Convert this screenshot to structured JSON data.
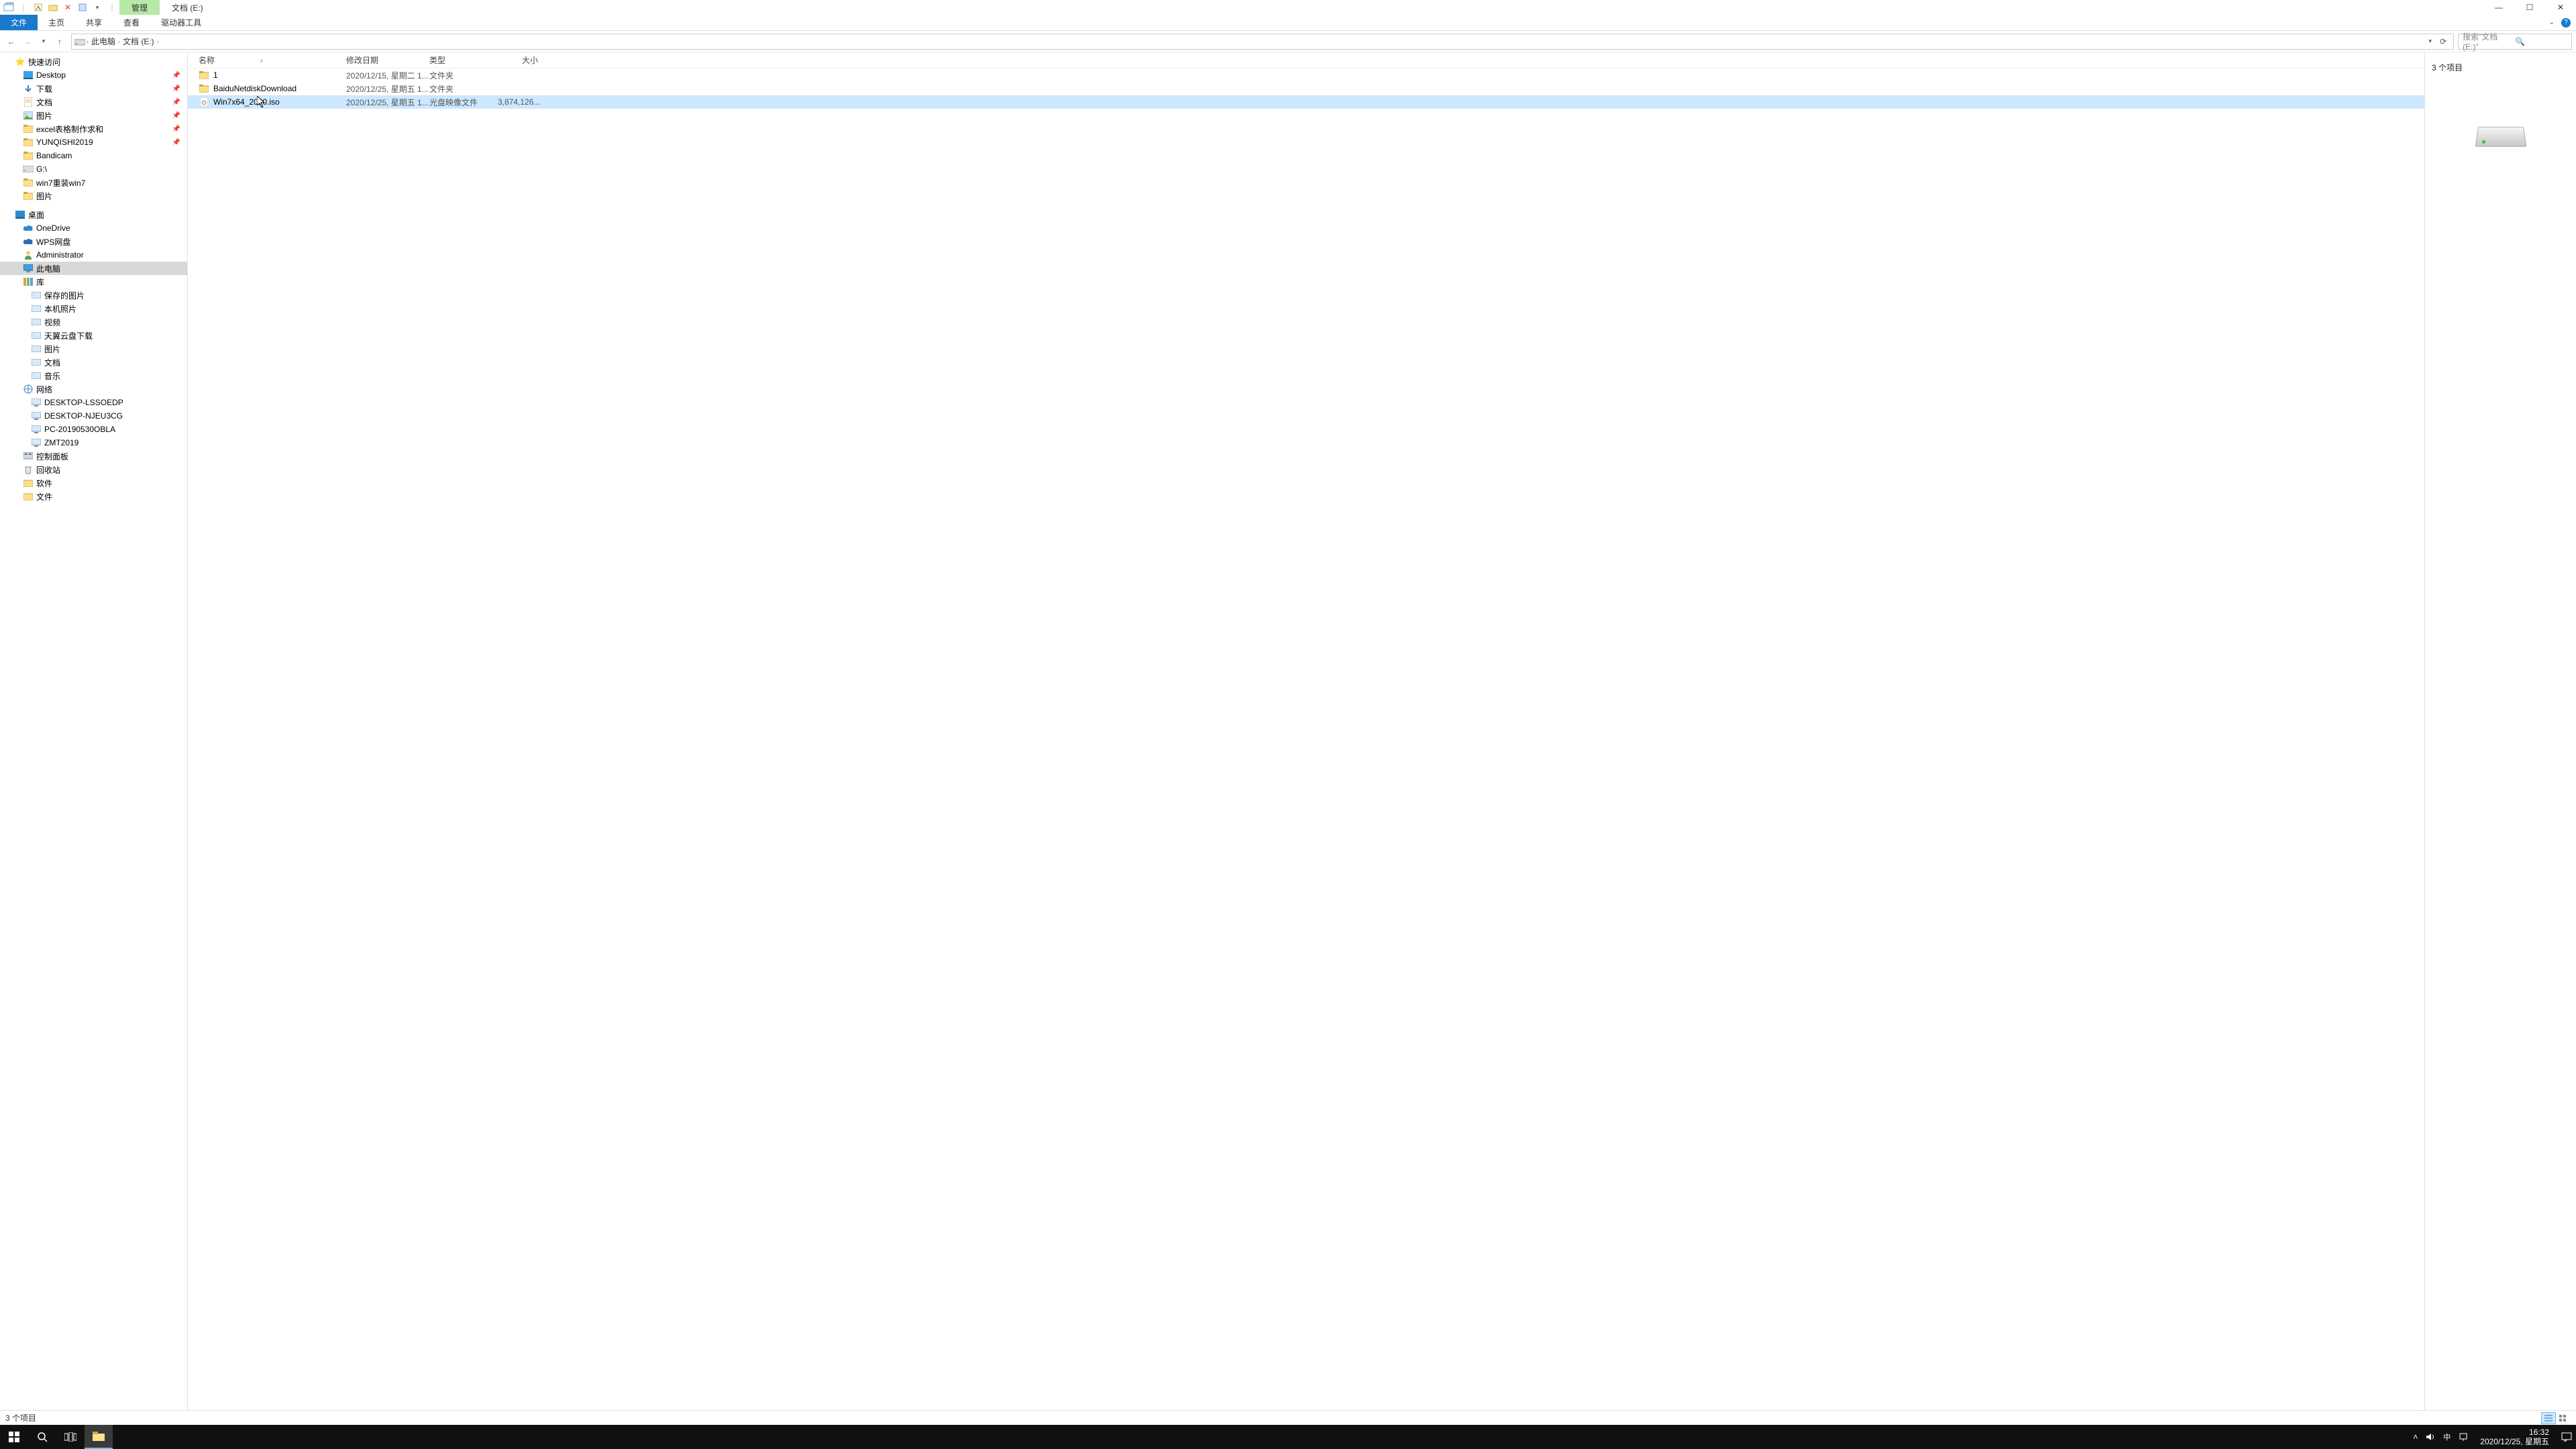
{
  "title_tab": {
    "manage": "管理",
    "location": "文档 (E:)"
  },
  "ribbon": {
    "file": "文件",
    "home": "主页",
    "share": "共享",
    "view": "查看",
    "drivetools": "驱动器工具"
  },
  "breadcrumbs": {
    "pc": "此电脑",
    "loc": "文档 (E:)"
  },
  "search": {
    "placeholder": "搜索\"文档 (E:)\""
  },
  "columns": {
    "name": "名称",
    "date": "修改日期",
    "type": "类型",
    "size": "大小"
  },
  "files": [
    {
      "name": "1",
      "date": "2020/12/15, 星期二 1...",
      "type": "文件夹",
      "size": ""
    },
    {
      "name": "BaiduNetdiskDownload",
      "date": "2020/12/25, 星期五 1...",
      "type": "文件夹",
      "size": ""
    },
    {
      "name": "Win7x64_2020.iso",
      "date": "2020/12/25, 星期五 1...",
      "type": "光盘映像文件",
      "size": "3,874,126..."
    }
  ],
  "preview": {
    "count": "3 个项目"
  },
  "status": {
    "text": "3 个项目"
  },
  "tree": {
    "quick": "快速访问",
    "quick_items": [
      {
        "l": "Desktop",
        "pin": true,
        "i": "desktop"
      },
      {
        "l": "下载",
        "pin": true,
        "i": "down"
      },
      {
        "l": "文档",
        "pin": true,
        "i": "doc"
      },
      {
        "l": "图片",
        "pin": true,
        "i": "pic"
      },
      {
        "l": "excel表格制作求和",
        "pin": true,
        "i": "folder"
      },
      {
        "l": "YUNQISHI2019",
        "pin": true,
        "i": "folder"
      },
      {
        "l": "Bandicam",
        "pin": false,
        "i": "folder"
      },
      {
        "l": "G:\\",
        "pin": false,
        "i": "drive"
      },
      {
        "l": "win7重装win7",
        "pin": false,
        "i": "folder"
      },
      {
        "l": "图片",
        "pin": false,
        "i": "folder"
      }
    ],
    "desktop": "桌面",
    "desk_items": [
      {
        "l": "OneDrive",
        "i": "cloud"
      },
      {
        "l": "WPS网盘",
        "i": "cloud2"
      },
      {
        "l": "Administrator",
        "i": "user"
      },
      {
        "l": "此电脑",
        "i": "pc",
        "sel": true
      },
      {
        "l": "库",
        "i": "lib"
      }
    ],
    "lib_items": [
      {
        "l": "保存的图片"
      },
      {
        "l": "本机照片"
      },
      {
        "l": "视频"
      },
      {
        "l": "天翼云盘下载"
      },
      {
        "l": "图片"
      },
      {
        "l": "文档"
      },
      {
        "l": "音乐"
      }
    ],
    "network": "网络",
    "net_items": [
      {
        "l": "DESKTOP-LSSOEDP"
      },
      {
        "l": "DESKTOP-NJEU3CG"
      },
      {
        "l": "PC-20190530OBLA"
      },
      {
        "l": "ZMT2019"
      }
    ],
    "ctrl": "控制面板",
    "recycle": "回收站",
    "soft": "软件",
    "docf": "文件"
  },
  "clock": {
    "time": "16:32",
    "date": "2020/12/25, 星期五"
  }
}
